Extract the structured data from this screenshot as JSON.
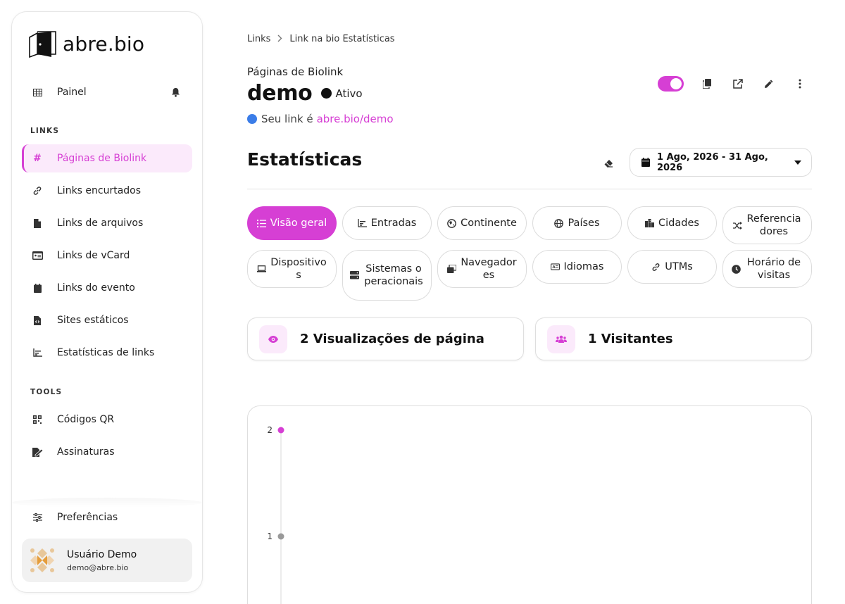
{
  "app": {
    "brand": "abre.bio"
  },
  "sidebar": {
    "top_item": {
      "label": "Painel",
      "icon": "table-icon"
    },
    "section_links": "LINKS",
    "links": [
      {
        "label": "Páginas de Biolink",
        "icon": "hash-icon",
        "active": true
      },
      {
        "label": "Links encurtados",
        "icon": "link-icon"
      },
      {
        "label": "Links de arquivos",
        "icon": "file-icon"
      },
      {
        "label": "Links de vCard",
        "icon": "id-card-icon"
      },
      {
        "label": "Links do evento",
        "icon": "calendar-icon"
      },
      {
        "label": "Sites estáticos",
        "icon": "file-code-icon"
      },
      {
        "label": "Estatísticas de links",
        "icon": "chart-icon"
      }
    ],
    "section_tools": "TOOLS",
    "tools": [
      {
        "label": "Códigos QR",
        "icon": "qrcode-icon"
      },
      {
        "label": "Assinaturas",
        "icon": "signature-icon"
      }
    ],
    "preferences": {
      "label": "Preferências",
      "icon": "sliders-icon"
    },
    "user": {
      "name": "Usuário Demo",
      "email": "demo@abre.bio"
    }
  },
  "breadcrumb": {
    "items": [
      "Links",
      "Link na bio Estatísticas"
    ]
  },
  "header": {
    "eyebrow": "Páginas de Biolink",
    "title": "demo",
    "status": "Ativo",
    "link_prefix": "Seu link é",
    "link_url": "abre.bio/demo",
    "toggle_on": true
  },
  "stats": {
    "title": "Estatísticas",
    "date_range": "1 Ago, 2026 - 31 Ago, 2026"
  },
  "tabs": [
    {
      "label": "Visão geral",
      "icon": "list-icon",
      "active": true
    },
    {
      "label": "Entradas",
      "icon": "chart-icon"
    },
    {
      "label": "Continente",
      "icon": "globe-europe-icon"
    },
    {
      "label": "Países",
      "icon": "globe-icon"
    },
    {
      "label": "Cidades",
      "icon": "city-icon"
    },
    {
      "label": "Referenciadores",
      "icon": "shuffle-icon"
    },
    {
      "label": "Dispositivos",
      "icon": "laptop-icon"
    },
    {
      "label": "Sistemas operacionais",
      "icon": "server-icon"
    },
    {
      "label": "Navegadores",
      "icon": "windows-icon"
    },
    {
      "label": "Idiomas",
      "icon": "language-icon"
    },
    {
      "label": "UTMs",
      "icon": "link-icon"
    },
    {
      "label": "Horário de visitas",
      "icon": "clock-icon"
    }
  ],
  "cards": [
    {
      "label": "2 Visualizações de página",
      "icon": "eye-icon"
    },
    {
      "label": "1 Visitantes",
      "icon": "users-icon"
    }
  ],
  "chart_data": {
    "type": "line",
    "title": "",
    "xlabel": "",
    "ylabel": "",
    "y_ticks": [
      "2",
      "1"
    ],
    "series": [
      {
        "name": "",
        "color": "#d63fd4",
        "values": [
          2
        ]
      },
      {
        "name": "",
        "color": "#999999",
        "values": [
          1
        ]
      }
    ],
    "colors": {
      "accent": "#d63fd4"
    }
  }
}
